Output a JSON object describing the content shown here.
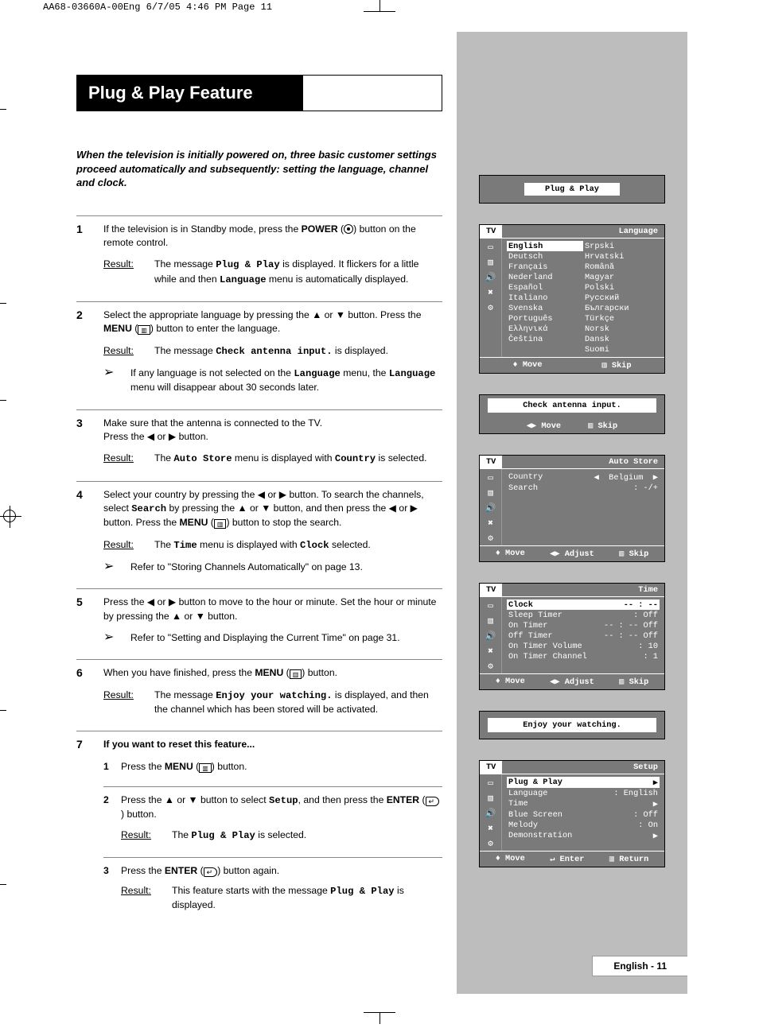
{
  "preflight": "AA68-03660A-00Eng  6/7/05  4:46 PM  Page 11",
  "page_title": "Plug & Play Feature",
  "intro": "When the television is initially powered on, three basic customer settings proceed automatically and subsequently: setting the language, channel and clock.",
  "steps": {
    "s1": {
      "num": "1",
      "text_a": "If the television is in Standby mode, press the ",
      "power": "POWER",
      "text_b": " button on the remote control.",
      "result_a": "The message ",
      "mono1": "Plug & Play",
      "result_b": " is displayed. It flickers for a little while and then ",
      "mono2": "Language",
      "result_c": " menu is automatically displayed."
    },
    "s2": {
      "num": "2",
      "text_a": "Select the appropriate language by pressing the ▲ or ▼ button. Press the ",
      "menu": "MENU",
      "text_b": " button to enter the language.",
      "result_a": "The message ",
      "mono1": "Check antenna input.",
      "result_b": " is displayed.",
      "note_a": "If any language is not selected on the ",
      "mono2": "Language",
      "note_b": " menu, the ",
      "mono3": "Language",
      "note_c": " menu will disappear about 30 seconds later."
    },
    "s3": {
      "num": "3",
      "text": "Make sure that the antenna is connected to the TV.\nPress the ◀ or ▶ button.",
      "result_a": "The ",
      "mono1": "Auto Store",
      "result_b": " menu is displayed with ",
      "mono2": "Country",
      "result_c": " is selected."
    },
    "s4": {
      "num": "4",
      "text_a": "Select your country by pressing the ◀ or ▶ button. To search the channels, select ",
      "mono_search": "Search",
      "text_b": " by pressing the ▲ or ▼ button, and then press the ◀ or ▶ button. Press the ",
      "menu": "MENU",
      "text_c": " button to stop the search.",
      "result_a": "The ",
      "mono1": "Time",
      "result_b": " menu is displayed with ",
      "mono2": "Clock",
      "result_c": " selected.",
      "note": "Refer to \"Storing Channels Automatically\" on page 13."
    },
    "s5": {
      "num": "5",
      "text": "Press the ◀ or ▶ button to move to the hour or minute. Set the hour or minute by pressing the ▲ or ▼ button.",
      "note": "Refer to \"Setting and Displaying the Current Time\" on page 31."
    },
    "s6": {
      "num": "6",
      "text_a": "When you have finished, press the ",
      "menu": "MENU",
      "text_b": " button.",
      "result_a": "The message ",
      "mono1": "Enjoy your watching.",
      "result_b": " is displayed, and then the channel which has been stored will be activated."
    },
    "s7": {
      "num": "7",
      "heading": "If you want to reset this feature...",
      "sub1": {
        "n": "1",
        "a": "Press the ",
        "menu": "MENU",
        "b": " button."
      },
      "sub2": {
        "n": "2",
        "a": "Press the ▲ or ▼ button to select ",
        "mono": "Setup",
        "b": ", and then press the ",
        "enter": "ENTER",
        "c": " button.",
        "result_a": "The ",
        "mono2": "Plug & Play",
        "result_b": " is selected."
      },
      "sub3": {
        "n": "3",
        "a": "Press the ",
        "enter": "ENTER",
        "b": " button again.",
        "result_a": "This feature starts with the message ",
        "mono": "Plug & Play",
        "result_b": " is displayed."
      }
    }
  },
  "labels": {
    "result": "Result:",
    "arrow": "➢"
  },
  "osd": {
    "plugplay_title": "Plug & Play",
    "lang": {
      "tab": "TV",
      "section": "Language",
      "left": [
        "English",
        "Deutsch",
        "Français",
        "Nederland",
        "Español",
        "Italiano",
        "Svenska",
        "Português",
        "Ελληνικά",
        "Čeština"
      ],
      "right": [
        "Srpski",
        "Hrvatski",
        "Română",
        "Magyar",
        "Polski",
        "Русский",
        "Български",
        "Türkçe",
        "Norsk",
        "Dansk",
        "Suomi"
      ],
      "ftr": {
        "move": "Move",
        "skip": "Skip"
      }
    },
    "antenna": {
      "msg": "Check antenna input.",
      "move": "Move",
      "skip": "Skip"
    },
    "autostore": {
      "tab": "TV",
      "section": "Auto Store",
      "rows": [
        {
          "k": "Country",
          "v": "Belgium",
          "arrows": "◀        ▶"
        },
        {
          "k": "Search",
          "v": ": -/+"
        }
      ],
      "ftr": {
        "move": "Move",
        "adjust": "Adjust",
        "skip": "Skip"
      }
    },
    "time": {
      "tab": "TV",
      "section": "Time",
      "rows": [
        {
          "k": "Clock",
          "v": "-- : --",
          "sel": true
        },
        {
          "k": "Sleep Timer",
          "v": ": Off"
        },
        {
          "k": "On Timer",
          "v": "-- : -- Off"
        },
        {
          "k": "Off Timer",
          "v": "-- : -- Off"
        },
        {
          "k": "On Timer Volume",
          "v": ": 10"
        },
        {
          "k": "On Timer Channel",
          "v": ": 1"
        }
      ],
      "ftr": {
        "move": "Move",
        "adjust": "Adjust",
        "skip": "Skip"
      }
    },
    "enjoy": "Enjoy your watching.",
    "setup": {
      "tab": "TV",
      "section": "Setup",
      "rows": [
        {
          "k": "Plug & Play",
          "v": "▶",
          "sel": true
        },
        {
          "k": "Language",
          "v": ": English"
        },
        {
          "k": "Time",
          "v": "▶"
        },
        {
          "k": "Blue Screen",
          "v": ": Off"
        },
        {
          "k": "Melody",
          "v": ": On"
        },
        {
          "k": "Demonstration",
          "v": "▶"
        }
      ],
      "ftr": {
        "move": "Move",
        "enter": "Enter",
        "return": "Return"
      }
    }
  },
  "page_number": "English - 11",
  "glyph": {
    "up": "▲",
    "down": "▼",
    "left": "◀",
    "right": "▶",
    "updown": "♦",
    "leftright": "◀▶",
    "menu_icon": "▥",
    "enter_icon": "↵"
  }
}
